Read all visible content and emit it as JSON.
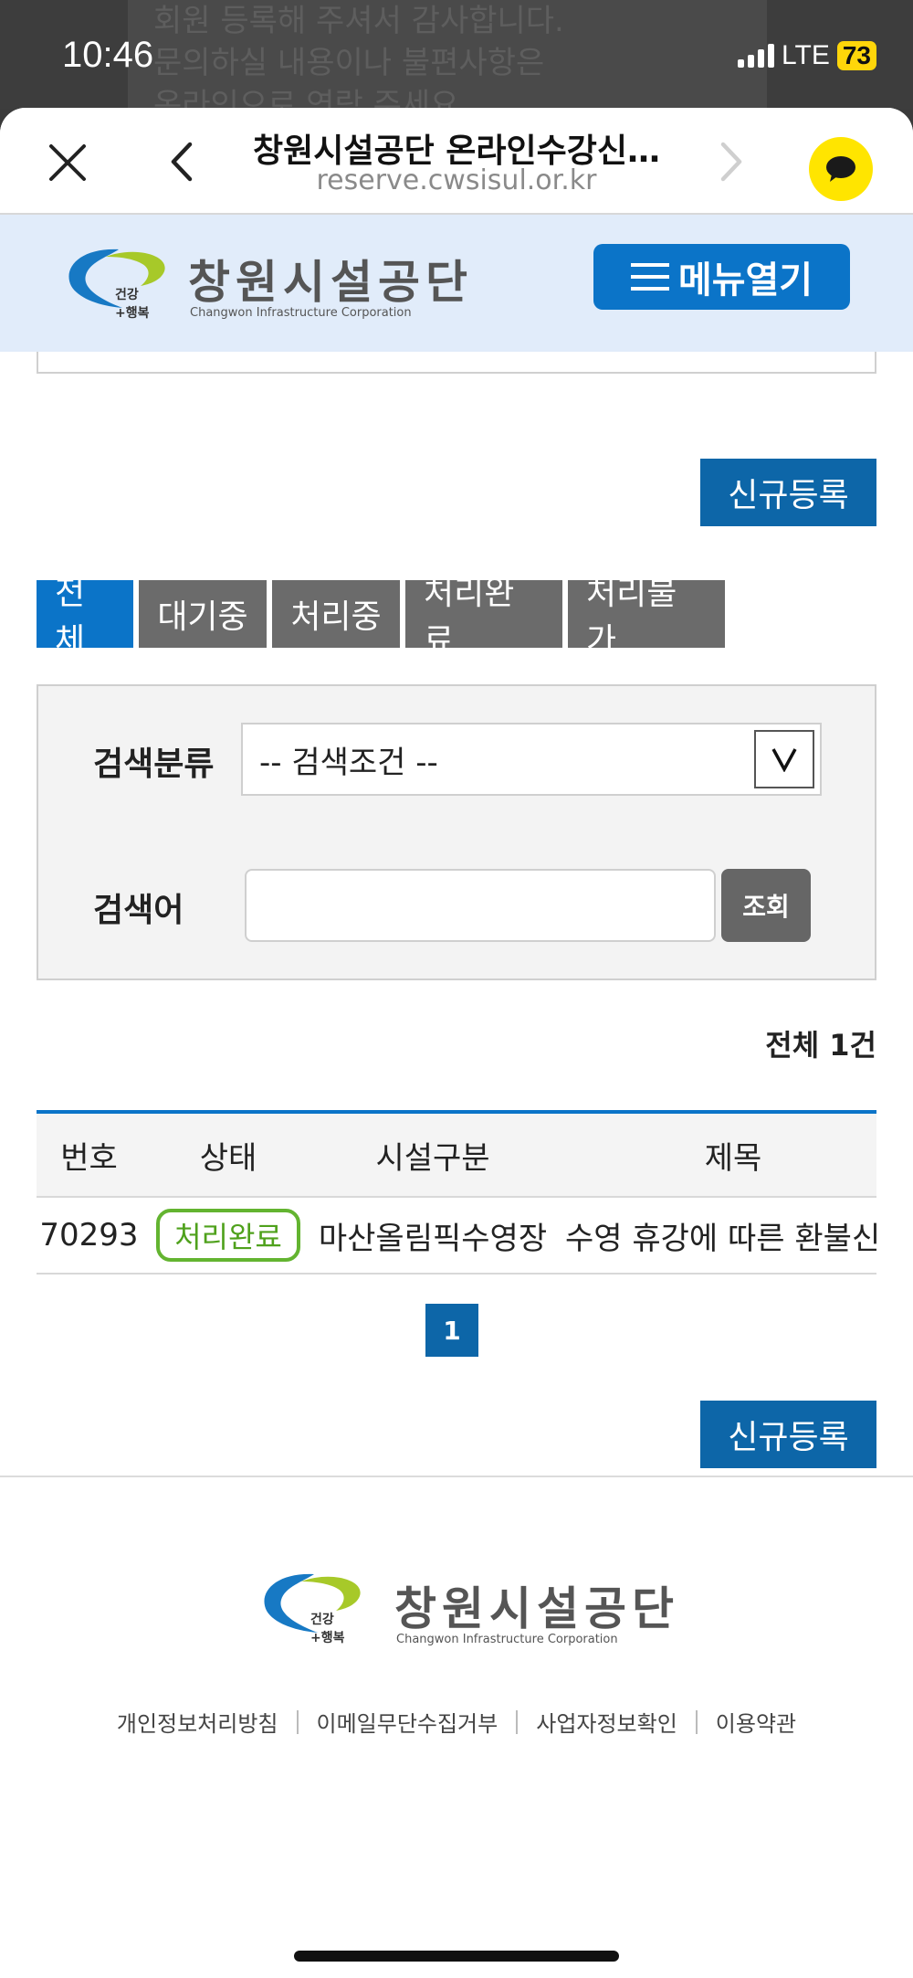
{
  "status_bar": {
    "time": "10:46",
    "network": "LTE",
    "battery": "73",
    "background_text": [
      "회원 등록해 주셔서 감사합니다.",
      "문의하실 내용이나 불편사항은",
      "온라인으로 연락 주세요"
    ]
  },
  "browser": {
    "title": "창원시설공단 온라인수강신…",
    "url": "reserve.cwsisul.or.kr"
  },
  "site_header": {
    "logo_kr": "창원시설공단",
    "logo_en": "Changwon Infrastructure Corporation",
    "logo_tag": "건강+행복",
    "menu_button": "메뉴열기"
  },
  "actions": {
    "new_register": "신규등록"
  },
  "tabs": [
    {
      "label": "전체",
      "active": true
    },
    {
      "label": "대기중",
      "active": false
    },
    {
      "label": "처리중",
      "active": false
    },
    {
      "label": "처리완료",
      "active": false
    },
    {
      "label": "처리불가",
      "active": false
    }
  ],
  "search": {
    "category_label": "검색분류",
    "category_selected": "-- 검색조건 --",
    "keyword_label": "검색어",
    "keyword_value": "",
    "button": "조회"
  },
  "total": "전체 1건",
  "table": {
    "headers": [
      "번호",
      "상태",
      "시설구분",
      "제목"
    ],
    "rows": [
      {
        "no": "70293",
        "status": "처리완료",
        "facility": "마산올림픽수영장",
        "title": "수영 휴강에 따른 환불신청"
      }
    ]
  },
  "pagination": {
    "current": "1"
  },
  "footer": {
    "links": [
      "개인정보처리방침",
      "이메일무단수집거부",
      "사업자정보확인",
      "이용약관"
    ]
  },
  "colors": {
    "primary": "#0b74c8",
    "button_blue": "#0d66a8",
    "tab_gray": "#6b6b6b",
    "status_green": "#4fa11c",
    "header_bg": "#e1ecfa"
  }
}
